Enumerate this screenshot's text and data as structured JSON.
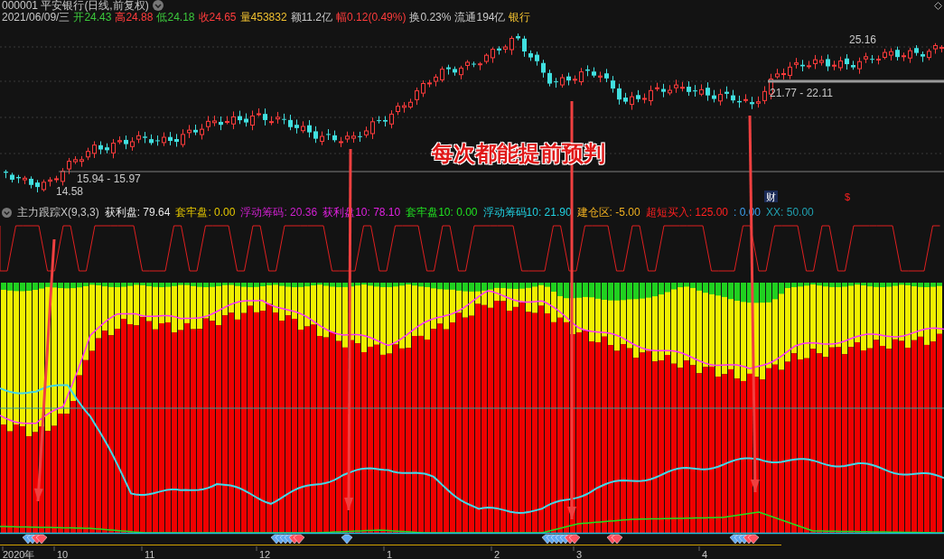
{
  "header": {
    "title": "000001 平安银行(日线,前复权)",
    "fields": [
      {
        "text": "2021/06/09/三",
        "color": "#c8c8c8"
      },
      {
        "text": "开24.43",
        "color": "#3cc83c"
      },
      {
        "text": "高24.88",
        "color": "#ff3c3c"
      },
      {
        "text": "低24.18",
        "color": "#3cc83c"
      },
      {
        "text": "收24.65",
        "color": "#ff3c3c"
      },
      {
        "text": "量453832",
        "color": "#f0c030"
      },
      {
        "text": "额11.2亿",
        "color": "#c8c8c8"
      },
      {
        "text": "幅0.12(0.49%)",
        "color": "#ff3c3c"
      },
      {
        "text": "换0.23%",
        "color": "#c8c8c8"
      },
      {
        "text": "流通194亿",
        "color": "#c8c8c8"
      },
      {
        "text": "银行",
        "color": "#f0c030"
      }
    ]
  },
  "price_labels": [
    {
      "text": "25.16",
      "kind": "high"
    },
    {
      "text": "21.77 - 22.11",
      "kind": "range"
    },
    {
      "text": "15.94 - 15.97",
      "kind": "range"
    },
    {
      "text": "14.58",
      "kind": "low"
    }
  ],
  "event_markers": [
    {
      "text": "财",
      "kind": "finance"
    },
    {
      "text": "$",
      "kind": "dividend"
    }
  ],
  "annotation": "每次都能提前预判",
  "indicator": {
    "title": "主力跟踪X(9,3,3)",
    "values": [
      {
        "text": "获利盘: 79.64",
        "color": "#e6e6e6"
      },
      {
        "text": "套牢盘: 0.00",
        "color": "#e6c800"
      },
      {
        "text": "浮动筹码: 20.36",
        "color": "#d020d0"
      },
      {
        "text": "获利盘10: 78.10",
        "color": "#e020e0"
      },
      {
        "text": "套牢盘10: 0.00",
        "color": "#20e020"
      },
      {
        "text": "浮动筹码10: 21.90",
        "color": "#20d0e0"
      },
      {
        "text": "建仓区: -5.00",
        "color": "#f0b020"
      },
      {
        "text": "超短买入: 125.00",
        "color": "#ff2020"
      },
      {
        "text": ": 0.00",
        "color": "#3ca0f0"
      },
      {
        "text": "XX: 50.00",
        "color": "#20a0b0"
      }
    ]
  },
  "axis_labels": [
    "2020年",
    "10",
    "11",
    "12",
    "1",
    "2",
    "3",
    "4"
  ]
}
